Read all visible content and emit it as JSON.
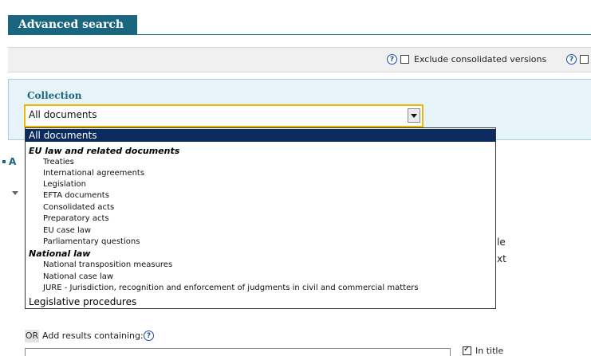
{
  "header": {
    "title": "Advanced search"
  },
  "options": {
    "help_glyph": "?",
    "exclude_consolidated_label": "Exclude consolidated versions"
  },
  "collection": {
    "label": "Collection",
    "selected_value": "All documents"
  },
  "dropdown": {
    "selected": "All documents",
    "groups": [
      {
        "label": "EU law and related documents",
        "items": [
          "Treaties",
          "International agreements",
          "Legislation",
          "EFTA documents",
          "Consolidated acts",
          "Preparatory acts",
          "EU case law",
          "Parliamentary questions"
        ]
      },
      {
        "label": "National law",
        "items": [
          "National transposition measures",
          "National case law",
          "JURE - Jurisdiction, recognition and enforcement of judgments in civil and commercial matters"
        ]
      }
    ],
    "last_item": "Legislative procedures"
  },
  "background": {
    "side_letter": "A",
    "right_fragment_1": "le",
    "right_fragment_2": "xt"
  },
  "bottom": {
    "or_label": "OR",
    "add_results_label": "Add results containing:",
    "in_title_label": "In title"
  },
  "colors": {
    "brand": "#19667e",
    "dropdown_selected_bg": "#0b2a5e",
    "focus_border": "#f2b705",
    "panel_bg": "#e6f3f9"
  }
}
